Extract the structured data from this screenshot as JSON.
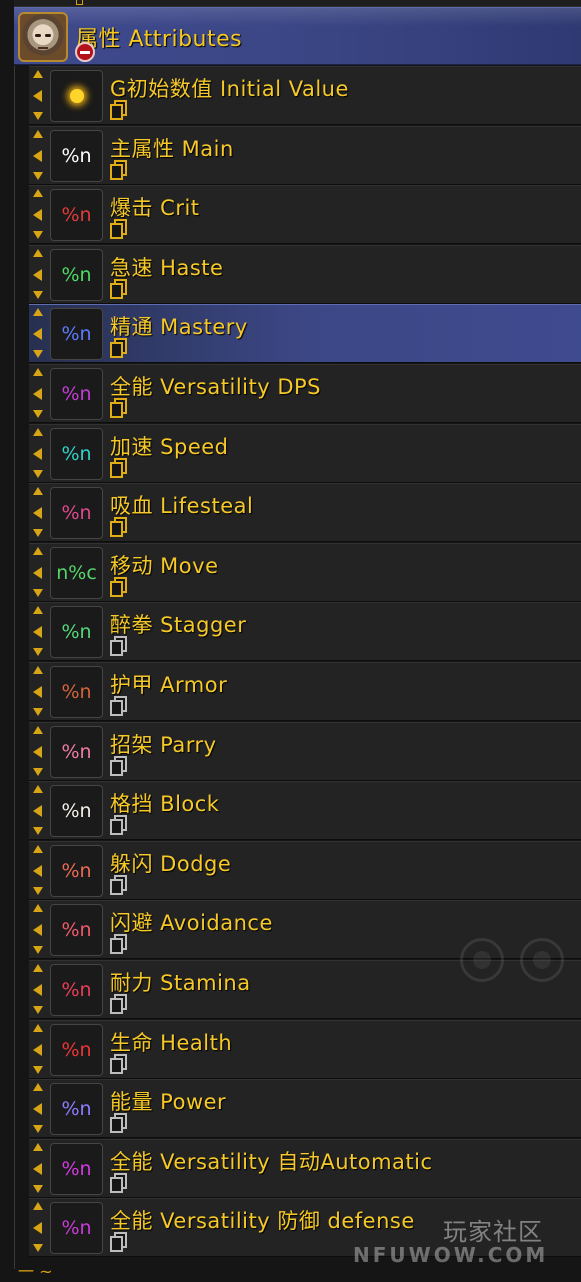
{
  "group": {
    "title": "属性 Attributes",
    "icon": "character-portrait",
    "collapse_icon": "minus-circle-icon"
  },
  "rows": [
    {
      "label": "G初始数值 Initial Value",
      "icon_type": "sun",
      "icon_text": "",
      "icon_color": "#ffd52a",
      "doc_color": "gold",
      "selected": false
    },
    {
      "label": "主属性 Main",
      "icon_type": "text",
      "icon_text": "%n",
      "icon_color": "#ffffff",
      "doc_color": "gold",
      "selected": false
    },
    {
      "label": "爆击 Crit",
      "icon_type": "text",
      "icon_text": "%n",
      "icon_color": "#e33b3b",
      "doc_color": "gold",
      "selected": false
    },
    {
      "label": "急速 Haste",
      "icon_type": "text",
      "icon_text": "%n",
      "icon_color": "#4cdc63",
      "doc_color": "gold",
      "selected": false
    },
    {
      "label": "精通 Mastery",
      "icon_type": "text",
      "icon_text": "%n",
      "icon_color": "#5b7bff",
      "doc_color": "gold",
      "selected": true
    },
    {
      "label": "全能 Versatility DPS",
      "icon_type": "text",
      "icon_text": "%n",
      "icon_color": "#c43cd6",
      "doc_color": "gold",
      "selected": false
    },
    {
      "label": "加速 Speed",
      "icon_type": "text",
      "icon_text": "%n",
      "icon_color": "#2fd3c7",
      "doc_color": "gold",
      "selected": false
    },
    {
      "label": "吸血 Lifesteal",
      "icon_type": "text",
      "icon_text": "%n",
      "icon_color": "#e0488f",
      "doc_color": "gold",
      "selected": false
    },
    {
      "label": "移动 Move",
      "icon_type": "text",
      "icon_text": "n%c",
      "icon_color": "#56d66a",
      "doc_color": "gold",
      "selected": false
    },
    {
      "label": "醉拳 Stagger",
      "icon_type": "text",
      "icon_text": "%n",
      "icon_color": "#53d979",
      "doc_color": "gray",
      "selected": false
    },
    {
      "label": "护甲 Armor",
      "icon_type": "text",
      "icon_text": "%n",
      "icon_color": "#d4643a",
      "doc_color": "gray",
      "selected": false
    },
    {
      "label": "招架 Parry",
      "icon_type": "text",
      "icon_text": "%n",
      "icon_color": "#f07ca4",
      "doc_color": "gray",
      "selected": false
    },
    {
      "label": "格挡 Block",
      "icon_type": "text",
      "icon_text": "%n",
      "icon_color": "#f2efe6",
      "doc_color": "gray",
      "selected": false
    },
    {
      "label": "躲闪 Dodge",
      "icon_type": "text",
      "icon_text": "%n",
      "icon_color": "#ea6b52",
      "doc_color": "gray",
      "selected": false
    },
    {
      "label": "闪避 Avoidance",
      "icon_type": "text",
      "icon_text": "%n",
      "icon_color": "#ef5a6a",
      "doc_color": "gray",
      "selected": false
    },
    {
      "label": "耐力 Stamina",
      "icon_type": "text",
      "icon_text": "%n",
      "icon_color": "#eb3d57",
      "doc_color": "gray",
      "selected": false
    },
    {
      "label": "生命 Health",
      "icon_type": "text",
      "icon_text": "%n",
      "icon_color": "#ea3636",
      "doc_color": "gray",
      "selected": false
    },
    {
      "label": "能量 Power",
      "icon_type": "text",
      "icon_text": "%n",
      "icon_color": "#8b7cff",
      "doc_color": "gray",
      "selected": false
    },
    {
      "label": "全能 Versatility 自动Automatic",
      "icon_type": "text",
      "icon_text": "%n",
      "icon_color": "#d23ae0",
      "doc_color": "gray",
      "selected": false
    },
    {
      "label": "全能 Versatility 防御 defense",
      "icon_type": "text",
      "icon_text": "%n",
      "icon_color": "#c83bd6",
      "doc_color": "gray",
      "selected": false
    }
  ],
  "watermark": {
    "line1": "玩家社区",
    "line2": "NFUWOW.COM"
  },
  "bottom_fragment": "一 ~"
}
